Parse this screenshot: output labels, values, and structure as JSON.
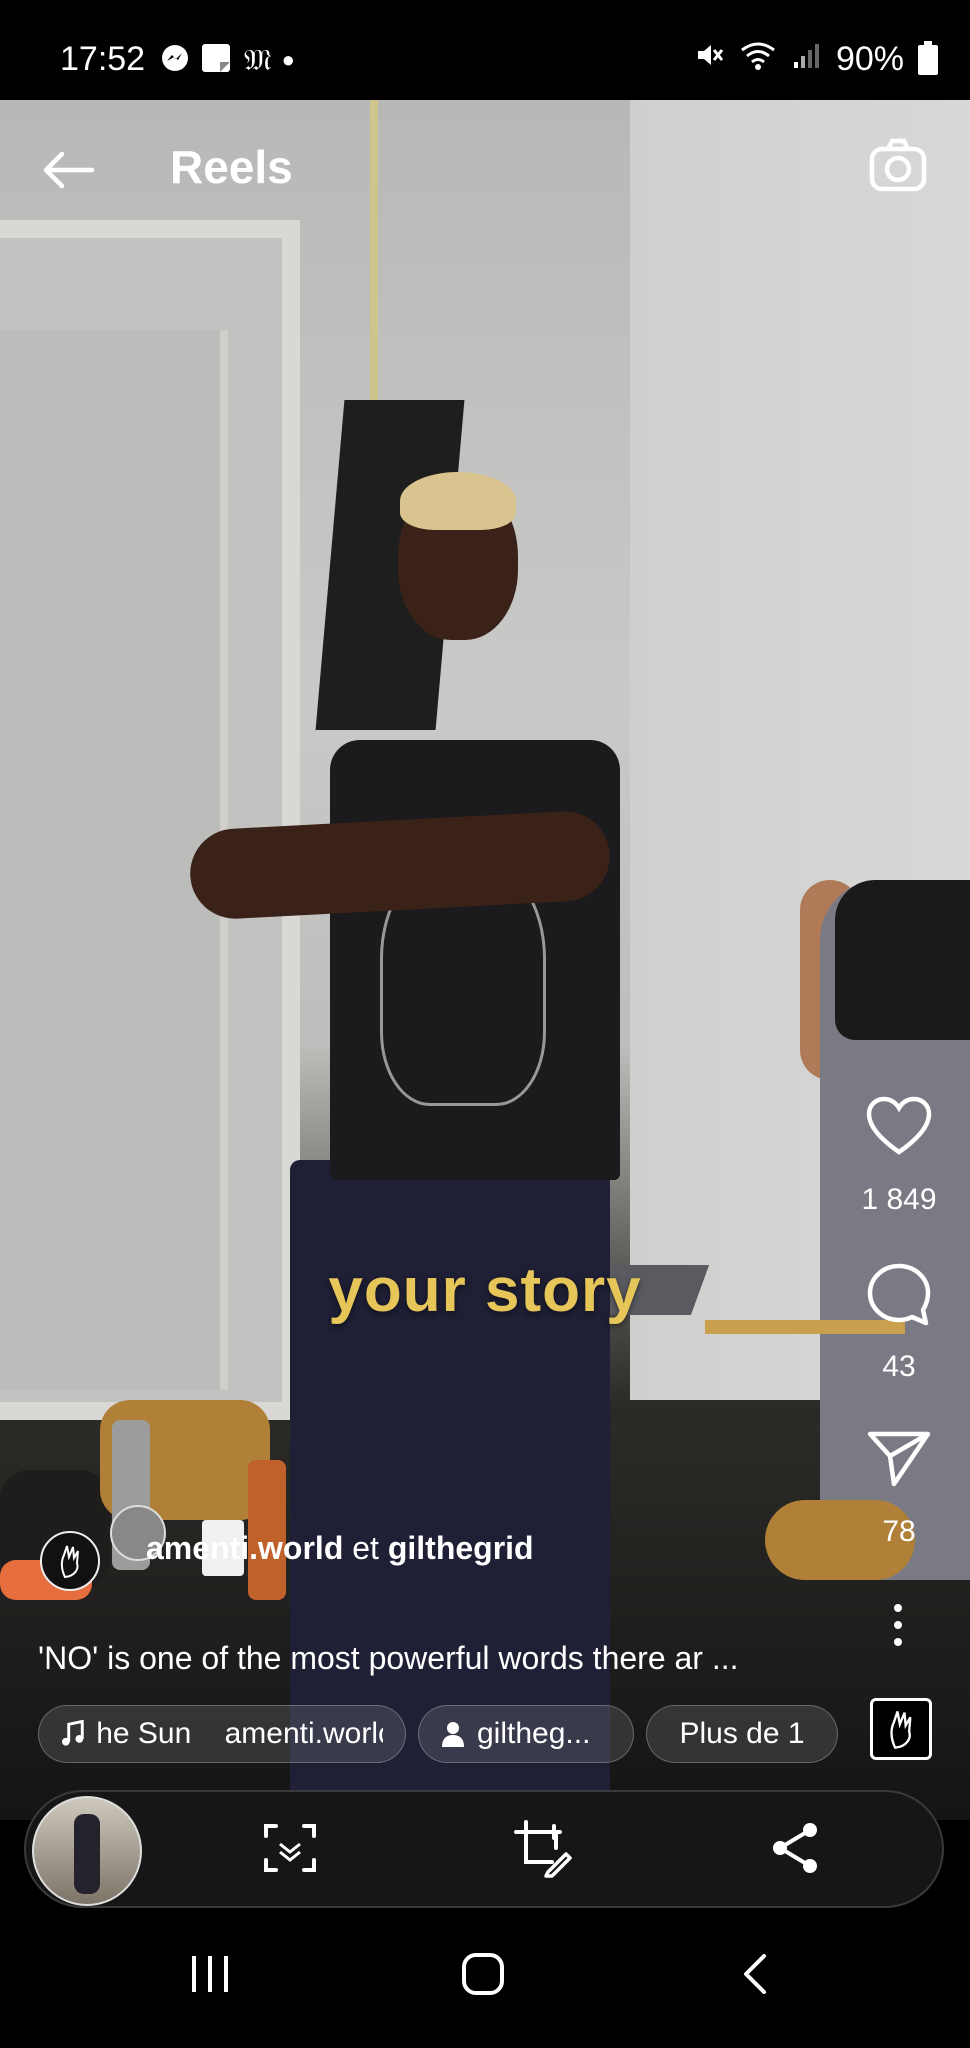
{
  "status_bar": {
    "time": "17:52",
    "left_icons": [
      "messenger-icon",
      "sticky-note-icon",
      "mail-m-icon",
      "dot-icon"
    ],
    "battery": "90%",
    "right_icons": [
      "mute-icon",
      "wifi-icon",
      "signal-icon",
      "battery-icon"
    ]
  },
  "header": {
    "title": "Reels"
  },
  "video": {
    "caption_overlay": "your story"
  },
  "rail": {
    "likes": "1 849",
    "comments": "43",
    "shares": "78"
  },
  "post": {
    "author_1": "amenti.world",
    "joiner": " et ",
    "author_2": "gilthegrid",
    "description": "'NO' is one of the most powerful words there ar ..."
  },
  "chips": {
    "audio_text": "he Sun    amenti.worlc",
    "tagged_user": "giltheg...",
    "more": "Plus de 1"
  },
  "colors": {
    "caption": "#e6c659",
    "background": "#000000"
  }
}
